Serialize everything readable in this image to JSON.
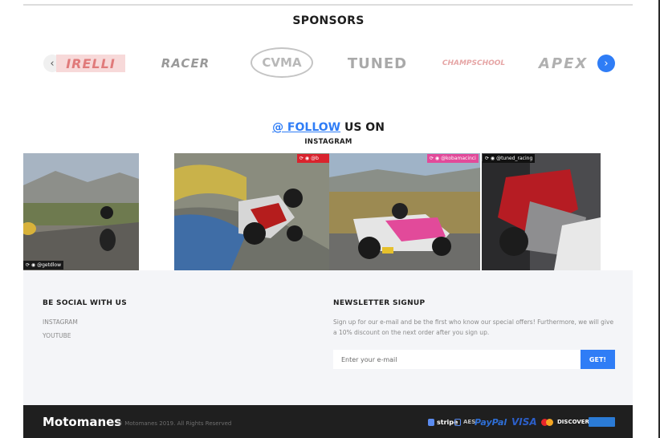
{
  "sponsors": {
    "title": "SPONSORS",
    "prev_icon": "‹",
    "next_icon": "›",
    "logos": [
      {
        "name": "pirelli",
        "text": "IRELLI"
      },
      {
        "name": "racer",
        "text": "RACER"
      },
      {
        "name": "cvma",
        "text": "CVMA"
      },
      {
        "name": "tuned",
        "text": "TUNED"
      },
      {
        "name": "champschool",
        "text": "CHAMPSCHOOL"
      },
      {
        "name": "apex",
        "text": "APEX"
      }
    ]
  },
  "follow": {
    "link": "@ FOLLOW",
    "rest": " US ON",
    "subtitle": "INSTAGRAM"
  },
  "instagram": {
    "tiles": [
      {
        "handle": "@getdlow"
      },
      {
        "handle": "@b"
      },
      {
        "handle": "@kobamacinci"
      },
      {
        "handle": "@tuned_racing"
      }
    ]
  },
  "footer": {
    "social_heading": "BE SOCIAL WITH US",
    "social_links": [
      "INSTAGRAM",
      "YOUTUBE"
    ],
    "newsletter_heading": "NEWSLETTER SIGNUP",
    "newsletter_text": "Sign up for our e-mail and be the first who know our special offers! Furthermore, we will give a 10% discount on the next order after you sign up.",
    "email_placeholder": "Enter your e-mail",
    "submit_label": "GET!",
    "brand": "Motomanes",
    "copyright": "© Motomanes 2019. All Rights Reserved",
    "payments": [
      "stripe",
      "AES",
      "PayPal",
      "VISA",
      "DISCOVER"
    ]
  },
  "colors": {
    "accent": "#2f7df6",
    "footer_dark": "#1f1f1f",
    "footer_light": "#f4f5f8"
  }
}
